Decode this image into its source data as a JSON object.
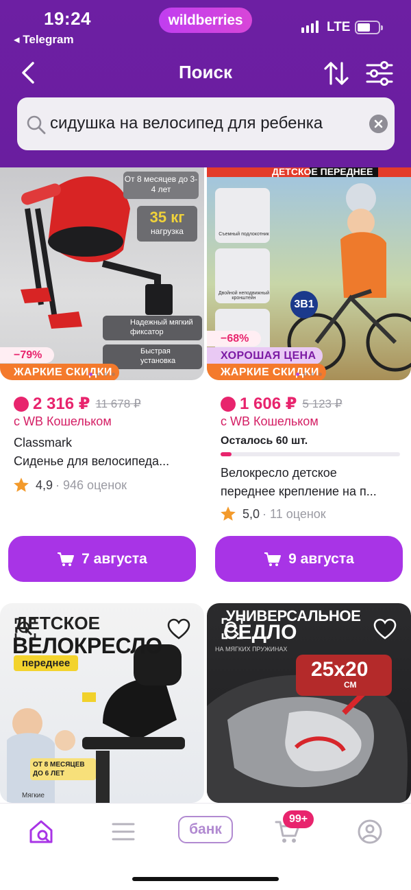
{
  "status_bar": {
    "time": "19:24",
    "back_app": "◂ Telegram",
    "network": "LTE",
    "brand": "wildberries"
  },
  "header": {
    "title": "Поиск",
    "back_icon": "chevron-left-icon",
    "sort_icon": "sort-arrows-icon",
    "filter_icon": "filter-sliders-icon"
  },
  "search": {
    "query": "сидушка на велосипед для ребенка"
  },
  "products": [
    {
      "image_texts": [
        "От 8 месяцев до 3-4 лет",
        "35 кг",
        "нагрузка",
        "Надежный мягкий фиксатор",
        "Быстрая установка"
      ],
      "discount": "−79%",
      "promo_tag": "ЖАРКИЕ СКИДКИ",
      "price": "2 316 ₽",
      "old_price": "11 678 ₽",
      "wallet_note": "с WB Кошельком",
      "brand": "Classmark",
      "name": "Сиденье для велосипеда...",
      "rating": "4,9",
      "reviews": "· 946 оценок",
      "button_label": "7 августа"
    },
    {
      "image_texts": [
        "ДЕТСКОЕ ПЕРЕДНЕЕ",
        "Съемный подлокотник",
        "Двойной неподвижный кронштейн",
        "3В1"
      ],
      "discount": "−68%",
      "good_price_tag": "ХОРОШАЯ ЦЕНА",
      "promo_tag": "ЖАРКИЕ СКИДКИ",
      "price": "1 606 ₽",
      "old_price": "5 123 ₽",
      "wallet_note": "с WB Кошельком",
      "stock_label": "Осталось 60 шт.",
      "stock_fraction": 0.06,
      "name_line1": "Велокресло детское",
      "name_line2": "переднее крепление на п...",
      "rating": "5,0",
      "reviews": "· 11 оценок",
      "button_label": "9 августа"
    },
    {
      "image_texts": [
        "ДЕТСКОЕ",
        "ВЕЛОКРЕСЛО",
        "переднее",
        "ОТ 8 МЕСЯЦЕВ ДО 6 ЛЕТ",
        "Мягкие"
      ]
    },
    {
      "image_texts": [
        "УНИВЕРСАЛЬНОЕ",
        "СЕДЛО",
        "НА МЯГКИХ ПРУЖИНАХ",
        "25x20",
        "СМ"
      ]
    }
  ],
  "bottom_nav": {
    "bank_label": "банк",
    "cart_badge": "99+",
    "icons": [
      "home-search-icon",
      "menu-icon",
      "bank-icon",
      "cart-icon",
      "profile-icon"
    ]
  },
  "colors": {
    "header_purple": "#6d1fa3",
    "accent_purple": "#a834e6",
    "price_pink": "#e8246d",
    "hot_orange": "#f47a2c"
  }
}
